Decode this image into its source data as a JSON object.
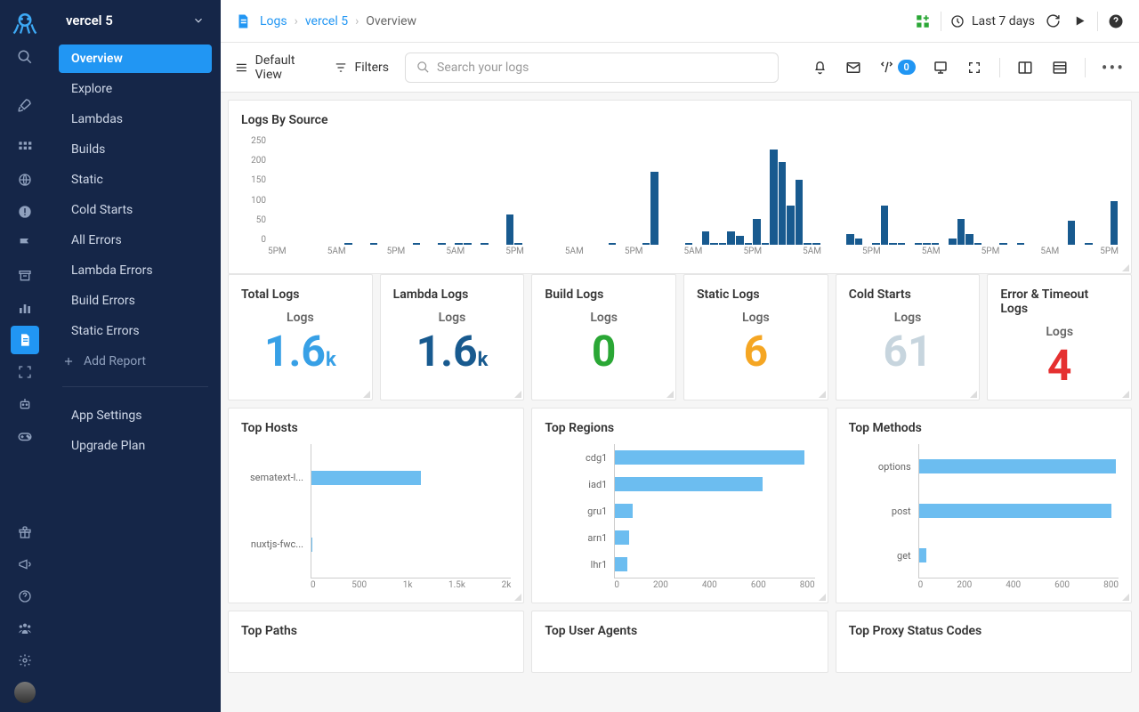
{
  "app_name": "vercel 5",
  "breadcrumbs": {
    "root": "Logs",
    "project": "vercel 5",
    "page": "Overview"
  },
  "time_range": "Last 7 days",
  "toolbar": {
    "view": "Default View",
    "filters": "Filters",
    "search_ph": "Search your logs",
    "badge": "0"
  },
  "sidebar": {
    "items": [
      "Overview",
      "Explore",
      "Lambdas",
      "Builds",
      "Static",
      "Cold Starts",
      "All Errors",
      "Lambda Errors",
      "Build Errors",
      "Static Errors"
    ],
    "add": "Add Report",
    "footer": [
      "App Settings",
      "Upgrade Plan"
    ]
  },
  "chart_data": {
    "logs_by_source": {
      "type": "bar",
      "title": "Logs By Source",
      "ylabel": "",
      "xlabel": "",
      "ylim": [
        0,
        250
      ],
      "yticks": [
        0,
        50,
        100,
        150,
        200,
        250
      ],
      "xticks": [
        "5PM",
        "5AM",
        "5PM",
        "5AM",
        "5PM",
        "5AM",
        "5PM",
        "5AM",
        "5PM",
        "5AM",
        "5PM",
        "5AM",
        "5PM",
        "5AM",
        "5PM"
      ],
      "values": [
        0,
        0,
        0,
        0,
        0,
        0,
        0,
        0,
        0,
        5,
        0,
        0,
        5,
        0,
        0,
        0,
        0,
        5,
        0,
        0,
        5,
        0,
        5,
        5,
        0,
        5,
        0,
        0,
        70,
        5,
        0,
        0,
        0,
        0,
        0,
        0,
        0,
        0,
        0,
        0,
        5,
        0,
        0,
        0,
        5,
        168,
        0,
        0,
        0,
        5,
        0,
        30,
        5,
        5,
        30,
        20,
        5,
        60,
        5,
        220,
        190,
        90,
        150,
        5,
        5,
        0,
        0,
        0,
        25,
        15,
        0,
        5,
        90,
        5,
        5,
        0,
        5,
        5,
        5,
        0,
        15,
        60,
        25,
        5,
        0,
        0,
        5,
        0,
        5,
        0,
        0,
        0,
        0,
        0,
        55,
        0,
        5,
        0,
        0,
        100
      ]
    },
    "top_hosts": {
      "type": "bar",
      "orientation": "h",
      "title": "Top Hosts",
      "categories": [
        "sematext-l...",
        "nuxtjs-fwc..."
      ],
      "values": [
        1100,
        10
      ],
      "xlim": [
        0,
        2000
      ],
      "xticks": [
        "0",
        "500",
        "1k",
        "1.5k",
        "2k"
      ]
    },
    "top_regions": {
      "type": "bar",
      "orientation": "h",
      "title": "Top Regions",
      "categories": [
        "cdg1",
        "iad1",
        "gru1",
        "arn1",
        "lhr1"
      ],
      "values": [
        760,
        590,
        70,
        55,
        50
      ],
      "xlim": [
        0,
        800
      ],
      "xticks": [
        "0",
        "200",
        "400",
        "600",
        "800"
      ]
    },
    "top_methods": {
      "type": "bar",
      "orientation": "h",
      "title": "Top Methods",
      "categories": [
        "options",
        "post",
        "get"
      ],
      "values": [
        790,
        770,
        30
      ],
      "xlim": [
        0,
        800
      ],
      "xticks": [
        "0",
        "200",
        "400",
        "600",
        "800"
      ]
    },
    "bottom_titles": [
      "Top Paths",
      "Top User Agents",
      "Top Proxy Status Codes"
    ]
  },
  "kpis": [
    {
      "title": "Total Logs",
      "sub": "Logs",
      "value": "1.6",
      "suffix": "k",
      "color": "#37a0e6"
    },
    {
      "title": "Lambda Logs",
      "sub": "Logs",
      "value": "1.6",
      "suffix": "k",
      "color": "#185a8f"
    },
    {
      "title": "Build Logs",
      "sub": "Logs",
      "value": "0",
      "suffix": "",
      "color": "#2aa735"
    },
    {
      "title": "Static Logs",
      "sub": "Logs",
      "value": "6",
      "suffix": "",
      "color": "#f5a623"
    },
    {
      "title": "Cold Starts",
      "sub": "Logs",
      "value": "61",
      "suffix": "",
      "color": "#c7d5de"
    },
    {
      "title": "Error & Timeout Logs",
      "sub": "Logs",
      "value": "4",
      "suffix": "",
      "color": "#e53030"
    }
  ]
}
